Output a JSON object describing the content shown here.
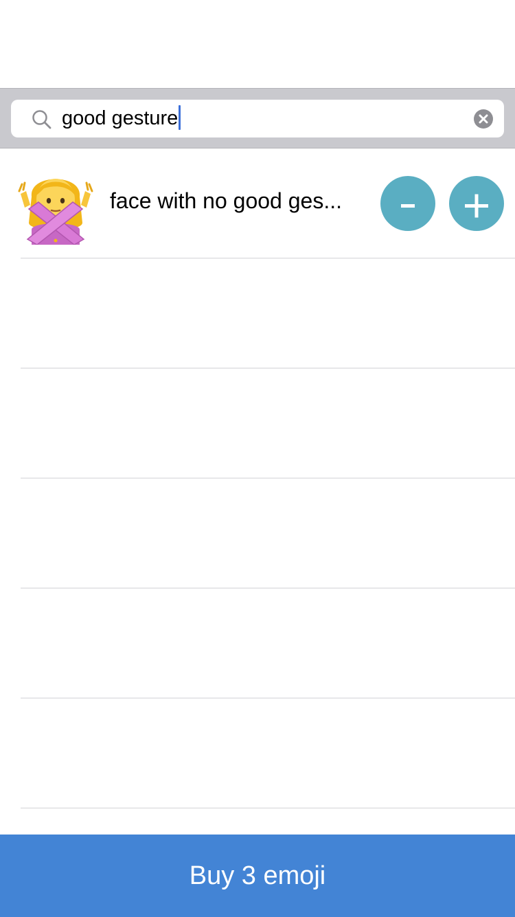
{
  "search": {
    "query": "good gesture",
    "icon": "search-icon",
    "clear_icon": "clear-icon"
  },
  "results": [
    {
      "emoji_icon": "face-with-no-good-gesture-emoji",
      "label": "face with no good ges...",
      "minus_label": "-",
      "plus_label": "+"
    }
  ],
  "empty_rows": 5,
  "footer": {
    "buy_label": "Buy 3 emoji"
  },
  "colors": {
    "search_bar_bg": "#c9c9ce",
    "round_button": "#5aaec2",
    "buy_button": "#4384d5",
    "caret": "#3b6fd9"
  }
}
